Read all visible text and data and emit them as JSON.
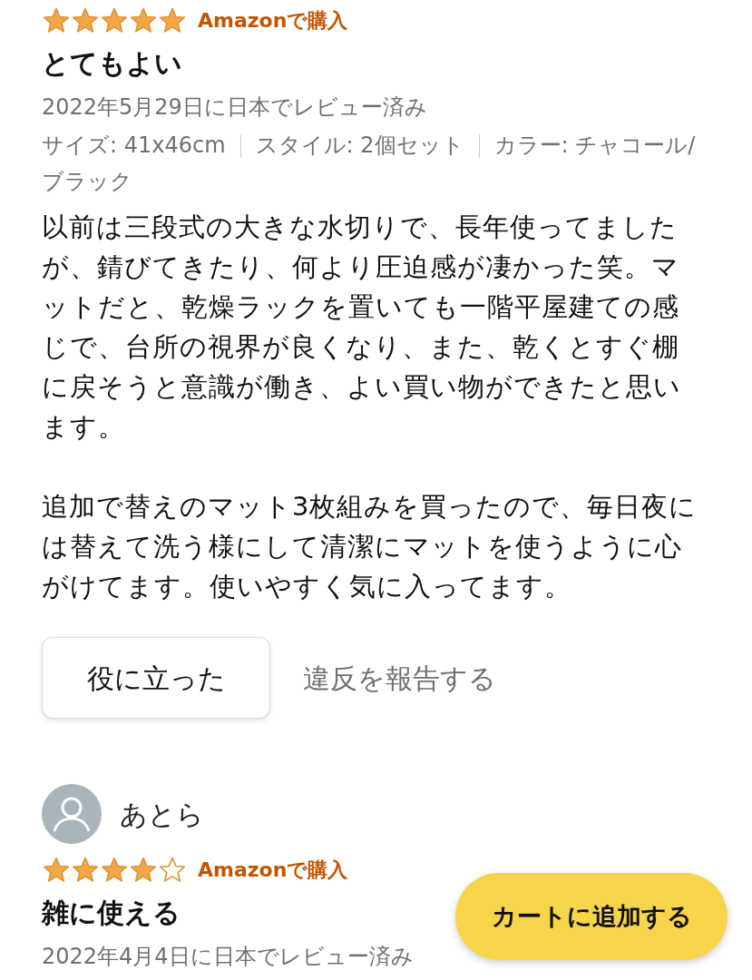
{
  "reviews": [
    {
      "stars": 5,
      "badge": "Amazonで購入",
      "title": "とてもよい",
      "date": "2022年5月29日に日本でレビュー済み",
      "variants": [
        "サイズ: 41x46cm",
        "スタイル: 2個セット",
        "カラー: チャコール/ブラック"
      ],
      "paragraphs": [
        "以前は三段式の大きな水切りで、長年使ってましたが、錆びてきたり、何より圧迫感が凄かった笑。マットだと、乾燥ラックを置いても一階平屋建ての感じで、台所の視界が良くなり、また、乾くとすぐ棚に戻そうと意識が働き、よい買い物ができたと思います。",
        "追加で替えのマット3枚組みを買ったので、毎日夜には替えて洗う様にして清潔にマットを使うように心がけてます。使いやすく気に入ってます。"
      ],
      "helpful_button": "役に立った",
      "report_link": "違反を報告する"
    },
    {
      "reviewer": "あとら",
      "stars": 4,
      "badge": "Amazonで購入",
      "title": "雑に使える",
      "date": "2022年4月4日に日本でレビュー済み"
    }
  ],
  "cart_button": "カートに追加する"
}
